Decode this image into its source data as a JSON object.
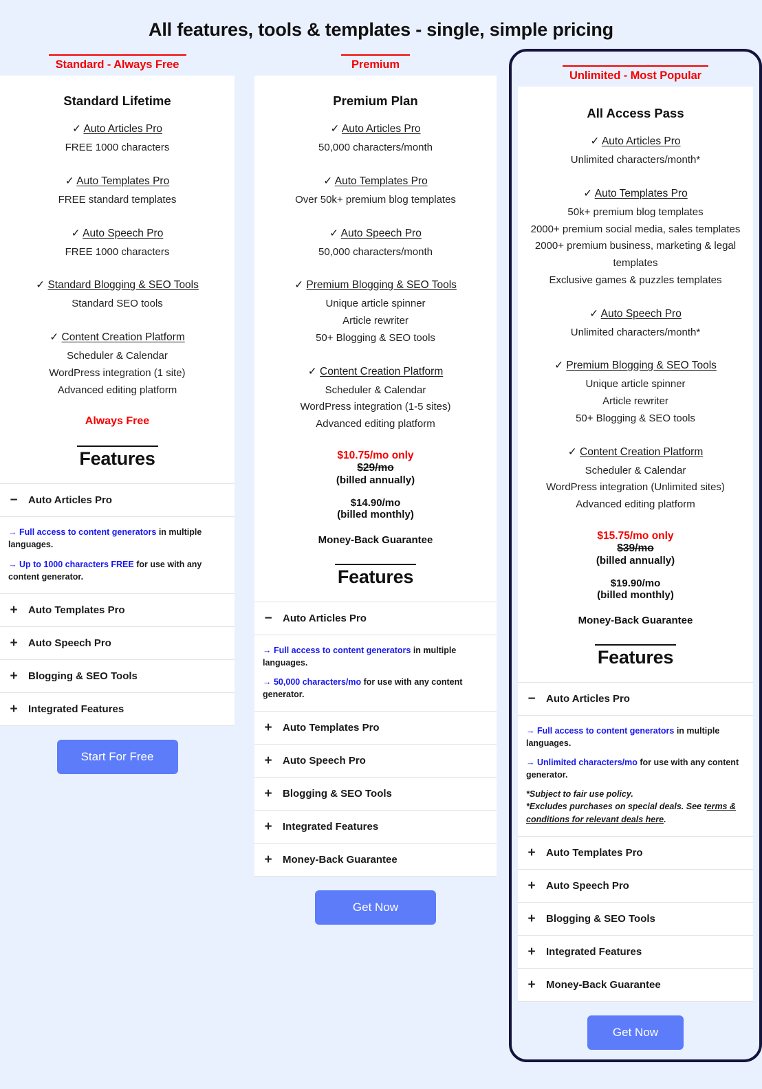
{
  "page": {
    "title": "All features, tools & templates - single, simple pricing",
    "background_color": "#eaf1fe",
    "accent_red": "#f40000",
    "accent_blue": "#1818ee",
    "button_color": "#5c7cfa",
    "highlight_border_color": "#14143c"
  },
  "plans": [
    {
      "label": "Standard - Always Free",
      "name": "Standard Lifetime",
      "highlighted": false,
      "groups": [
        {
          "check": "✓",
          "title": "Auto Articles Pro",
          "lines": [
            "FREE 1000 characters"
          ]
        },
        {
          "check": "✓",
          "title": "Auto Templates Pro",
          "lines": [
            "FREE standard templates"
          ]
        },
        {
          "check": "✓",
          "title": "Auto Speech Pro",
          "lines": [
            "FREE 1000 characters"
          ]
        },
        {
          "check": "✓",
          "title": "Standard Blogging & SEO Tools",
          "lines": [
            "Standard SEO tools"
          ]
        },
        {
          "check": "✓",
          "title": "Content Creation Platform",
          "lines": [
            "Scheduler & Calendar",
            "WordPress integration (1 site)",
            "Advanced editing platform"
          ]
        }
      ],
      "price": {
        "tagline": "Always Free"
      },
      "features_heading": "Features",
      "accordion": [
        {
          "sign": "−",
          "title": "Auto Articles Pro",
          "expanded": true,
          "body": [
            {
              "arrow": "→",
              "highlight": "Full access to content generators",
              "rest": " in multiple languages."
            },
            {
              "arrow": "→",
              "highlight": "Up to 1000 characters FREE",
              "rest": " for use with any content generator."
            }
          ]
        },
        {
          "sign": "+",
          "title": "Auto Templates Pro",
          "expanded": false
        },
        {
          "sign": "+",
          "title": "Auto Speech Pro",
          "expanded": false
        },
        {
          "sign": "+",
          "title": "Blogging & SEO Tools",
          "expanded": false
        },
        {
          "sign": "+",
          "title": "Integrated Features",
          "expanded": false
        }
      ],
      "cta": "Start For Free"
    },
    {
      "label": "Premium",
      "name": "Premium Plan",
      "highlighted": false,
      "groups": [
        {
          "check": "✓",
          "title": "Auto Articles Pro",
          "lines": [
            "50,000 characters/month"
          ]
        },
        {
          "check": "✓",
          "title": "Auto Templates Pro",
          "lines": [
            "Over 50k+ premium blog templates"
          ]
        },
        {
          "check": "✓",
          "title": "Auto Speech Pro",
          "lines": [
            "50,000 characters/month"
          ]
        },
        {
          "check": "✓",
          "title": "Premium Blogging & SEO Tools",
          "lines": [
            "Unique article spinner",
            "Article rewriter",
            "50+ Blogging & SEO tools"
          ]
        },
        {
          "check": "✓",
          "title": "Content Creation Platform",
          "lines": [
            "Scheduler & Calendar",
            "WordPress integration (1-5 sites)",
            "Advanced editing platform"
          ]
        }
      ],
      "price": {
        "main": "$10.75/mo only",
        "old": "$29/mo",
        "note": "(billed annually)",
        "alt": "$14.90/mo",
        "alt_note": "(billed monthly)",
        "guarantee": "Money-Back Guarantee"
      },
      "features_heading": "Features",
      "accordion": [
        {
          "sign": "−",
          "title": "Auto Articles Pro",
          "expanded": true,
          "body": [
            {
              "arrow": "→",
              "highlight": "Full access to content generators",
              "rest": " in multiple languages."
            },
            {
              "arrow": "→",
              "highlight": "50,000 characters/mo",
              "rest": " for use with any content generator."
            }
          ]
        },
        {
          "sign": "+",
          "title": "Auto Templates Pro",
          "expanded": false
        },
        {
          "sign": "+",
          "title": "Auto Speech Pro",
          "expanded": false
        },
        {
          "sign": "+",
          "title": "Blogging & SEO Tools",
          "expanded": false
        },
        {
          "sign": "+",
          "title": "Integrated Features",
          "expanded": false
        },
        {
          "sign": "+",
          "title": "Money-Back Guarantee",
          "expanded": false
        }
      ],
      "cta": "Get Now"
    },
    {
      "label": "Unlimited - Most Popular",
      "name": "All Access Pass",
      "highlighted": true,
      "groups": [
        {
          "check": "✓",
          "title": "Auto Articles Pro",
          "lines": [
            "Unlimited characters/month*"
          ]
        },
        {
          "check": "✓",
          "title": "Auto Templates Pro",
          "lines": [
            "50k+ premium blog templates",
            "2000+ premium social media, sales templates",
            "2000+ premium business, marketing & legal templates",
            "Exclusive games & puzzles templates"
          ]
        },
        {
          "check": "✓",
          "title": "Auto Speech Pro",
          "lines": [
            "Unlimited characters/month*"
          ]
        },
        {
          "check": "✓",
          "title": "Premium Blogging & SEO Tools",
          "lines": [
            "Unique article spinner",
            "Article rewriter",
            "50+ Blogging & SEO tools"
          ]
        },
        {
          "check": "✓",
          "title": "Content Creation Platform",
          "lines": [
            "Scheduler & Calendar",
            "WordPress integration (Unlimited sites)",
            "Advanced editing platform"
          ]
        }
      ],
      "price": {
        "main": "$15.75/mo only",
        "old": "$39/mo",
        "note": "(billed annually)",
        "alt": "$19.90/mo",
        "alt_note": "(billed monthly)",
        "guarantee": "Money-Back Guarantee"
      },
      "features_heading": "Features",
      "accordion": [
        {
          "sign": "−",
          "title": "Auto Articles Pro",
          "expanded": true,
          "body": [
            {
              "arrow": "→",
              "highlight": "Full access to content generators",
              "rest": " in multiple languages."
            },
            {
              "arrow": "→",
              "highlight": "Unlimited characters/mo",
              "rest": " for use with any content generator."
            }
          ],
          "fine_print": {
            "line1": "*Subject to fair use policy.",
            "line2_pre": "*Excludes purchases on special deals. See t",
            "line2_link": "erms & conditions for relevant deals here",
            "line2_post": "."
          }
        },
        {
          "sign": "+",
          "title": "Auto Templates Pro",
          "expanded": false
        },
        {
          "sign": "+",
          "title": "Auto Speech Pro",
          "expanded": false
        },
        {
          "sign": "+",
          "title": "Blogging & SEO Tools",
          "expanded": false
        },
        {
          "sign": "+",
          "title": "Integrated Features",
          "expanded": false
        },
        {
          "sign": "+",
          "title": "Money-Back Guarantee",
          "expanded": false
        }
      ],
      "cta": "Get Now"
    }
  ]
}
